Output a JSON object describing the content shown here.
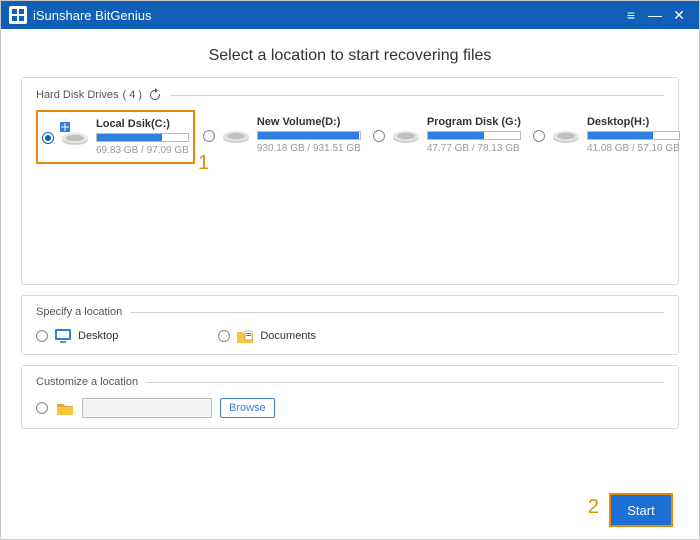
{
  "titlebar": {
    "app_name": "iSunshare BitGenius"
  },
  "page": {
    "title": "Select a location to start recovering files"
  },
  "sections": {
    "drives_label": "Hard Disk Drives",
    "drives_count": "( 4 )",
    "specify_label": "Specify a location",
    "customize_label": "Customize a location"
  },
  "drives": [
    {
      "name": "Local Dsik(C:)",
      "size": "69.83 GB / 97.09 GB",
      "fill_pct": 72,
      "selected": true,
      "os": true
    },
    {
      "name": "New Volume(D:)",
      "size": "930.18 GB / 931.51 GB",
      "fill_pct": 99,
      "selected": false,
      "os": false
    },
    {
      "name": "Program Disk (G:)",
      "size": "47.77 GB / 78.13 GB",
      "fill_pct": 61,
      "selected": false,
      "os": false
    },
    {
      "name": "Desktop(H:)",
      "size": "41.08 GB / 57.10 GB",
      "fill_pct": 72,
      "selected": false,
      "os": false
    }
  ],
  "locations": {
    "desktop": "Desktop",
    "documents": "Documents"
  },
  "custom": {
    "path": "",
    "browse": "Browse"
  },
  "footer": {
    "start": "Start"
  },
  "annotations": {
    "one": "1",
    "two": "2"
  }
}
